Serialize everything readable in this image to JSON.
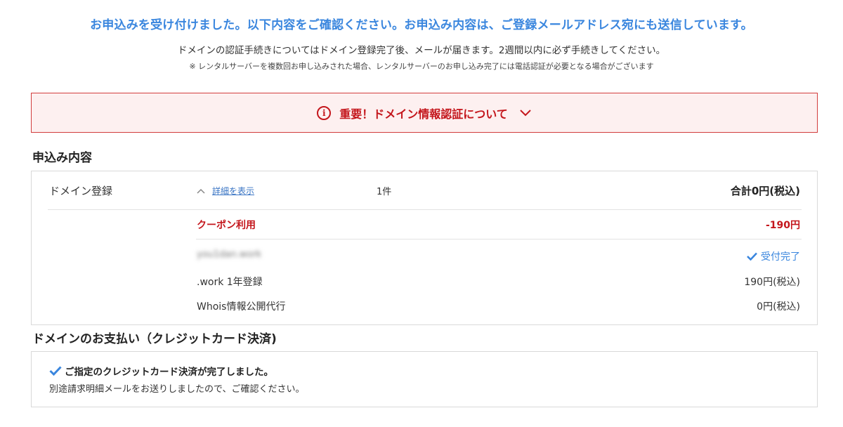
{
  "header": {
    "headline": "お申込みを受け付けました。以下内容をご確認ください。お申込み内容は、ご登録メールアドレス宛にも送信しています。",
    "subline": "ドメインの認証手続きについてはドメイン登録完了後、メールが届きます。2週間以内に必ず手続きしてください。",
    "note": "※ レンタルサーバーを複数回お申し込みされた場合、レンタルサーバーのお申し込み完了には電話認証が必要となる場合がございます"
  },
  "alert": {
    "icon": "info-icon",
    "icon_glyph": "i",
    "text": "重要！ドメイン情報認証について",
    "accent": "#c4161c",
    "background": "#fdf0f0"
  },
  "order": {
    "section_title": "申込み内容",
    "item_name": "ドメイン登録",
    "toggle_label": "詳細を表示",
    "quantity": "1件",
    "total": "合計0円(税込)",
    "coupon_label": "クーポン利用",
    "coupon_amount": "-190円",
    "domain": "you1dan.work",
    "status": "受付完了",
    "rows": [
      {
        "label": ".work 1年登録",
        "value": "190円(税込)"
      },
      {
        "label": "Whois情報公開代行",
        "value": "0円(税込)"
      }
    ]
  },
  "payment": {
    "section_title": "ドメインのお支払い（クレジットカード決済)",
    "title": "ご指定のクレジットカード決済が完了しました。",
    "description": "別途請求明細メールをお送りしましたので、ご確認ください。"
  },
  "colors": {
    "headline_blue": "#3a86de",
    "error_red": "#c4161c",
    "border_gray": "#d9d9d9"
  }
}
